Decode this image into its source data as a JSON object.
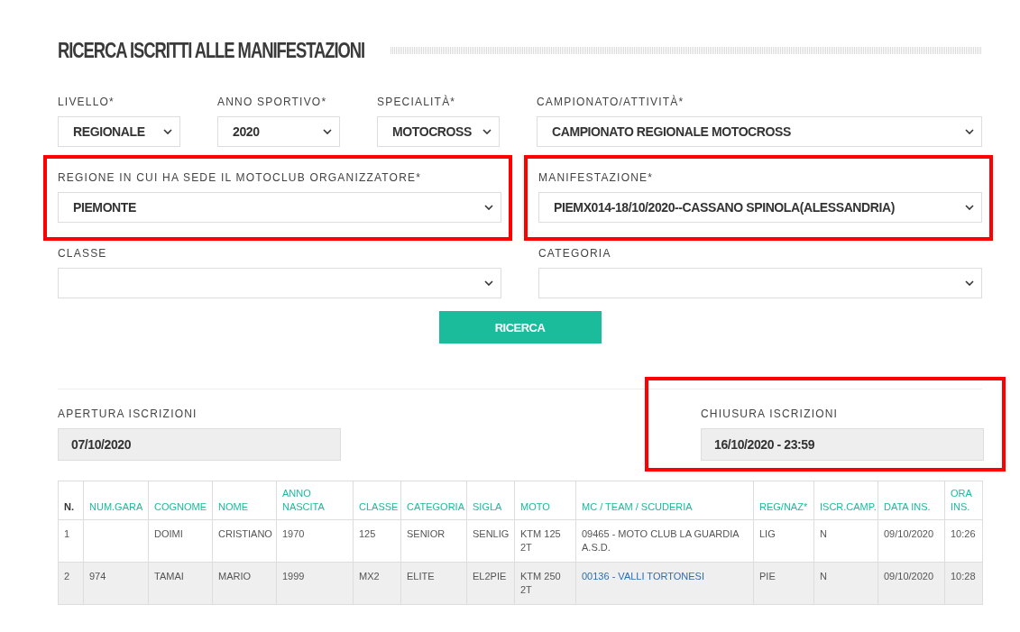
{
  "title": "RICERCA ISCRITTI ALLE MANIFESTAZIONI",
  "filter_rows": [
    [
      {
        "label": "LIVELLO*",
        "value": "REGIONALE",
        "highlighted": false
      },
      {
        "label": "ANNO SPORTIVO*",
        "value": "2020",
        "highlighted": false
      },
      {
        "label": "SPECIALITÀ*",
        "value": "MOTOCROSS",
        "highlighted": false
      },
      {
        "label": "CAMPIONATO/ATTIVITÀ*",
        "value": "CAMPIONATO REGIONALE MOTOCROSS",
        "highlighted": false
      }
    ],
    [
      {
        "label": "REGIONE IN CUI HA SEDE IL MOTOCLUB ORGANIZZATORE*",
        "value": "PIEMONTE",
        "highlighted": true
      },
      {
        "label": "MANIFESTAZIONE*",
        "value": "PIEMX014-18/10/2020--CASSANO SPINOLA(ALESSANDRIA)",
        "highlighted": true
      }
    ],
    [
      {
        "label": "CLASSE",
        "highlighted": false
      },
      {
        "label": "CATEGORIA",
        "highlighted": false
      }
    ]
  ],
  "search_button": "RICERCA",
  "dates": [
    {
      "label": "APERTURA ISCRIZIONI",
      "value": "07/10/2020",
      "highlighted": false
    },
    {
      "label": "CHIUSURA ISCRIZIONI",
      "value": "16/10/2020 - 23:59",
      "highlighted": true
    }
  ],
  "table": {
    "columns": [
      "N.",
      "NUM.GARA",
      "COGNOME",
      "NOME",
      "ANNO NASCITA",
      "CLASSE",
      "CATEGORIA",
      "SIGLA",
      "MOTO",
      "MC / TEAM / SCUDERIA",
      "REG/NAZ*",
      "ISCR.CAMP.",
      "DATA INS.",
      "ORA INS."
    ],
    "rows": [
      {
        "club_link": false,
        "cells": [
          "1",
          "",
          "DOIMI",
          "CRISTIANO",
          "1970",
          "125",
          "SENIOR",
          "SENLIG",
          "KTM 125 2T",
          "09465 - MOTO CLUB LA GUARDIA A.S.D.",
          "LIG",
          "N",
          "09/10/2020",
          "10:26"
        ]
      },
      {
        "club_link": true,
        "cells": [
          "2",
          "974",
          "TAMAI",
          "MARIO",
          "1999",
          "MX2",
          "ELITE",
          "EL2PIE",
          "KTM 250 2T",
          "00136 - VALLI TORTONESI",
          "PIE",
          "N",
          "09/10/2020",
          "10:28"
        ]
      }
    ]
  }
}
